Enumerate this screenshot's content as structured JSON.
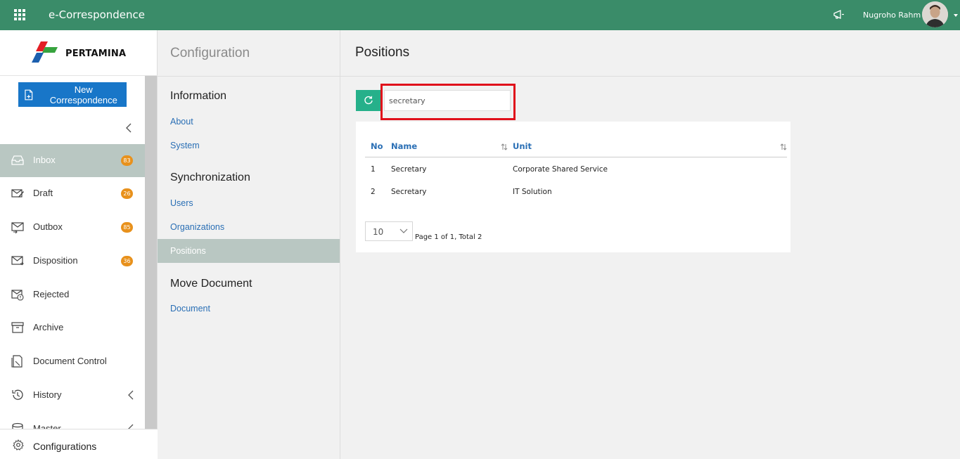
{
  "topbar": {
    "app_title": "e-Correspondence",
    "user_name": "Nugroho Rahm",
    "icons": [
      "apps-grid-icon",
      "megaphone-icon",
      "avatar",
      "caret-down-icon"
    ],
    "bg_color": "#3a8c69"
  },
  "logo": {
    "text": "PERTAMINA"
  },
  "sidebar": {
    "new_button_label": "New Correspondence",
    "items": [
      {
        "label": "Inbox",
        "badge": "83",
        "icon": "inbox-icon",
        "active": true
      },
      {
        "label": "Draft",
        "badge": "26",
        "icon": "draft-icon"
      },
      {
        "label": "Outbox",
        "badge": "85",
        "icon": "outbox-icon"
      },
      {
        "label": "Disposition",
        "badge": "36",
        "icon": "disposition-icon"
      },
      {
        "label": "Rejected",
        "badge": "",
        "icon": "rejected-icon"
      },
      {
        "label": "Archive",
        "badge": "",
        "icon": "archive-icon"
      },
      {
        "label": "Document Control",
        "badge": "",
        "icon": "document-control-icon"
      },
      {
        "label": "History",
        "badge": "",
        "icon": "history-icon"
      },
      {
        "label": "Master",
        "badge": "",
        "icon": "master-icon"
      }
    ],
    "footer_label": "Configurations",
    "active_color": "#b9c7c2",
    "badge_color": "#e8911c"
  },
  "config_panel": {
    "title": "Configuration",
    "sections": [
      {
        "heading": "Information",
        "links": [
          "About",
          "System"
        ]
      },
      {
        "heading": "Synchronization",
        "links": [
          "Users",
          "Organizations",
          "Positions"
        ]
      },
      {
        "heading": "Move Document",
        "links": [
          "Document"
        ]
      }
    ],
    "active_link": "Positions"
  },
  "main": {
    "title": "Positions",
    "search_value": "secretary",
    "table": {
      "headers": [
        "No",
        "Name",
        "Unit"
      ],
      "rows": [
        {
          "no": "1",
          "name": "Secretary",
          "unit": "Corporate Shared Service"
        },
        {
          "no": "2",
          "name": "Secretary",
          "unit": "IT Solution"
        }
      ]
    },
    "page_size": "10",
    "page_info": "Page 1 of 1, Total 2",
    "accent_color": "#26b08a",
    "link_color": "#2a6fb5",
    "highlight_color": "#e0101b"
  }
}
